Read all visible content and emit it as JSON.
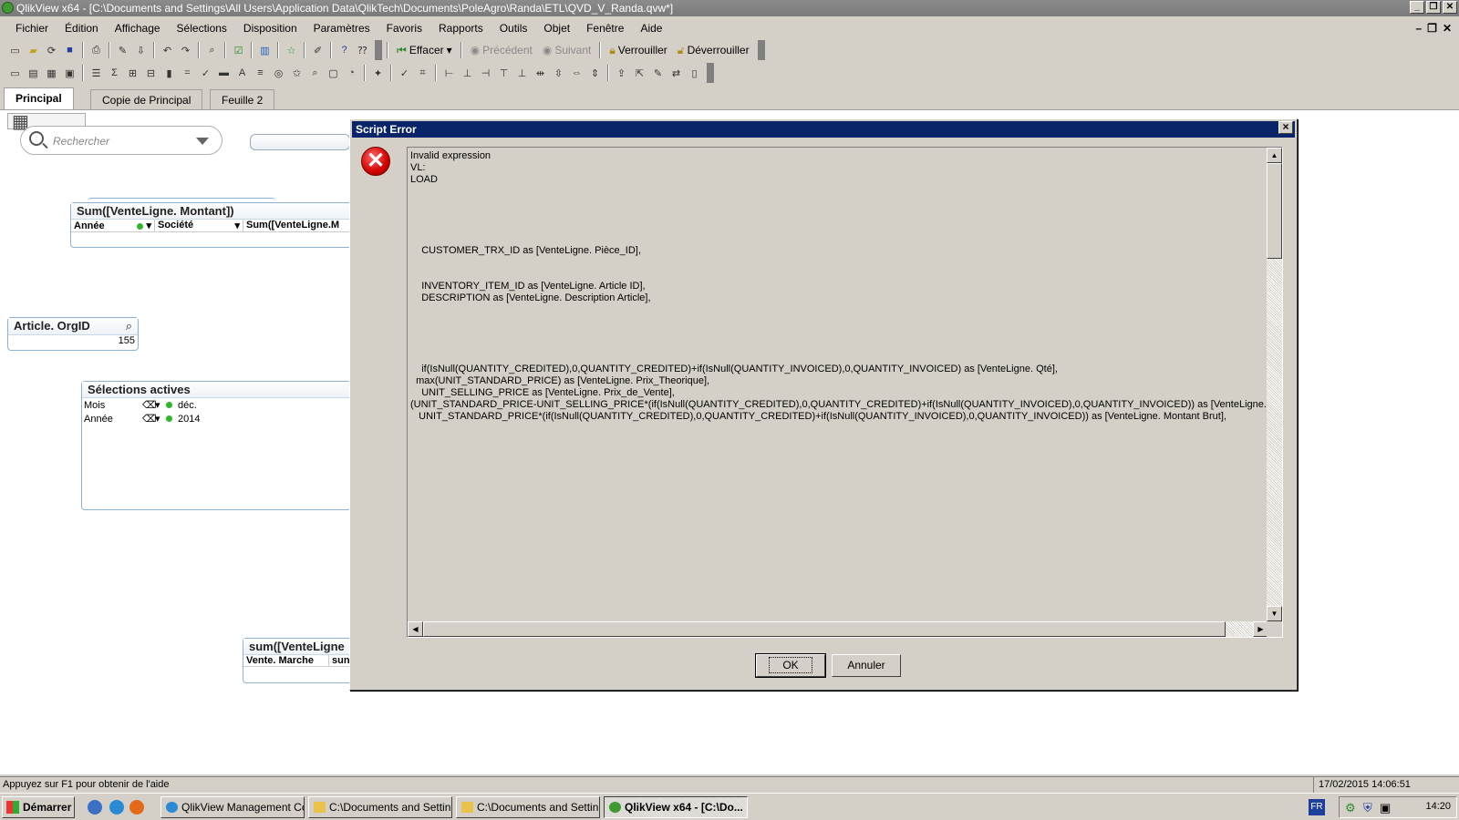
{
  "window": {
    "title": "QlikView x64 - [C:\\Documents and Settings\\All Users\\Application Data\\QlikTech\\Documents\\PoleAgro\\Randa\\ETL\\QVD_V_Randa.qvw*]"
  },
  "menu": [
    "Fichier",
    "Édition",
    "Affichage",
    "Sélections",
    "Disposition",
    "Paramètres",
    "Favoris",
    "Rapports",
    "Outils",
    "Objet",
    "Fenêtre",
    "Aide"
  ],
  "toolbar": {
    "clear": "Effacer",
    "back": "Précédent",
    "forward": "Suivant",
    "lock": "Verrouiller",
    "unlock": "Déverrouiller"
  },
  "tabs": [
    "Principal",
    "Copie de Principal",
    "Feuille 2"
  ],
  "search": {
    "placeholder": "Rechercher"
  },
  "sum_table": {
    "title": "Sum([VenteLigne. Montant])",
    "columns": [
      "Année",
      "Société",
      "Sum([VenteLigne.M"
    ]
  },
  "org_box": {
    "title": "Article. OrgID",
    "value": "155"
  },
  "active_selections": {
    "title": "Sélections actives",
    "rows": [
      {
        "field": "Mois",
        "value": "déc."
      },
      {
        "field": "Année",
        "value": "2014"
      }
    ]
  },
  "sum_table2": {
    "title": "sum([VenteLigne",
    "columns": [
      "Vente. Marche",
      "sun"
    ]
  },
  "dialog": {
    "title": "Script Error",
    "message": "Invalid expression\nVL:\nLOAD\n\n\n\n\n\n    CUSTOMER_TRX_ID as [VenteLigne. Pièce_ID],\n\n\n    INVENTORY_ITEM_ID as [VenteLigne. Article ID],\n    DESCRIPTION as [VenteLigne. Description Article],\n\n\n\n\n\n    if(IsNull(QUANTITY_CREDITED),0,QUANTITY_CREDITED)+if(IsNull(QUANTITY_INVOICED),0,QUANTITY_INVOICED) as [VenteLigne. Qté],\n  max(UNIT_STANDARD_PRICE) as [VenteLigne. Prix_Theorique],\n    UNIT_SELLING_PRICE as [VenteLigne. Prix_de_Vente],\n(UNIT_STANDARD_PRICE-UNIT_SELLING_PRICE*(if(IsNull(QUANTITY_CREDITED),0,QUANTITY_CREDITED)+if(IsNull(QUANTITY_INVOICED),0,QUANTITY_INVOICED)) as [VenteLigne. Ren\n   UNIT_STANDARD_PRICE*(if(IsNull(QUANTITY_CREDITED),0,QUANTITY_CREDITED)+if(IsNull(QUANTITY_INVOICED),0,QUANTITY_INVOICED)) as [VenteLigne. Montant Brut],",
    "ok": "OK",
    "cancel": "Annuler"
  },
  "status": {
    "help": "Appuyez sur F1 pour obtenir de l'aide",
    "datetime": "17/02/2015 14:06:51"
  },
  "taskbar": {
    "start": "Démarrer",
    "tasks": [
      "QlikView Management Co...",
      "C:\\Documents and Settin...",
      "C:\\Documents and Settin...",
      "QlikView x64 - [C:\\Do..."
    ],
    "lang": "FR",
    "clock": "14:20"
  },
  "colors": {
    "titlebar": "#7a7a7a",
    "dialog_title": "#0a246a",
    "face": "#d4d0c8",
    "error_red": "#d00000"
  }
}
